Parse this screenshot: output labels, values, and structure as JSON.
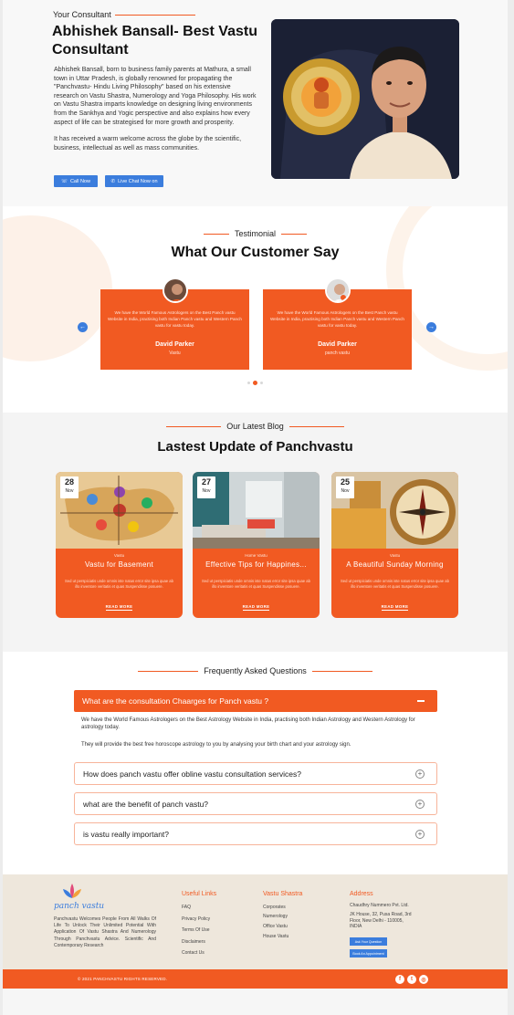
{
  "consultant": {
    "eyebrow": "Your Consultant",
    "title": "Abhishek Bansall- Best Vastu Consultant",
    "para1": "Abhishek Bansall, born to business family parents at Mathura, a small town in Uttar Pradesh, is globally renowned for propagating the \"Panchvastu- Hindu Living Philosophy\" based on his extensive research on Vastu Shastra, Numerology and Yoga Philosophy.  His work on Vastu Shastra imparts knowledge on designing living environments from the Sankhya and Yogic perspective and also explains how every aspect of life can be strategised for more growth and prosperity.",
    "para2": "It has received a warm welcome across the globe by the scientific, business, intellectual as well as mass communities.",
    "call_label": "Call Now",
    "chat_label": "Live Chat Now on"
  },
  "testimonial": {
    "eyebrow": "Testimonial",
    "title": "What Our Customer Say",
    "cards": [
      {
        "text": "We have the World Famous Astrologers on the Best Panch vastu Website in India, practising both Indian Panch vastu and Western Panch vastu for vastu today.",
        "name": "David Parker",
        "role": "Vastu"
      },
      {
        "text": "We have the World Famous Astrologers on the Best Panch vastu Website in India, practising both Indian Panch vastu and Western Panch vastu for vastu today.",
        "name": "David Parker",
        "role": "panch vastu"
      }
    ]
  },
  "blog": {
    "eyebrow": "Our Latest Blog",
    "title": "Lastest Update of Panchvastu",
    "read_more": "READ MORE",
    "posts": [
      {
        "day": "28",
        "month": "Nov",
        "category": "Vastu",
        "title": "Vastu for Basement",
        "excerpt": "Sed ut perspiciatis unde omnis iste natus error site ipsa quae ab illo inventore veritatis et quas Suspendisse posuere."
      },
      {
        "day": "27",
        "month": "Nov",
        "category": "Home Vastu",
        "title": "Effective  Tips for Happines...",
        "excerpt": "Sed ut perspiciatis unde omnis iste natus error site ipsa quae ab illo inventore veritatis et quas Suspendisse posuere."
      },
      {
        "day": "25",
        "month": "Nov",
        "category": "Vastu",
        "title": "A Beautiful Sunday Morning",
        "excerpt": "Sed ut perspiciatis unde omnis iste natus error site ipsa quae ab illo inventore veritatis et quas Suspendisse posuere."
      }
    ]
  },
  "faq": {
    "eyebrow": "Frequently Asked Questions",
    "open_question": "What are the consultation Chaarges for Panch vastu ?",
    "answer1": "We have the World Famous Astrologers on the Best Astrology Website in India, practising both Indian Astrology and Western Astrology for astrology today.",
    "answer2": "They will provide the best free horoscope astrology to you by analysing your birth chart and your astrology sign.",
    "questions": [
      "How does panch vastu offer obline vastu consultation services?",
      "what are the benefit of panch vastu?",
      "is vastu really important?"
    ]
  },
  "footer": {
    "logo_text": "panch vastu",
    "about": "Panchvastu Welcomes People From All Walks Of Life To Unlock Their Unlimited Potential With Application Of Vastu Shastra And Numerology Through Panchvastu Advice. Scientific And Contemporary Research",
    "useful_heading": "Useful Links",
    "useful_links": [
      "FAQ",
      "Privacy Policy",
      "Terms Of Use",
      "Disclaimers",
      "Contact Us"
    ],
    "vastu_heading": "Vastu Shastra",
    "vastu_links": [
      "Corporates",
      "Numerology",
      "Office Vastu",
      "House Vastu"
    ],
    "address_heading": "Address",
    "company": "Chaudhry Nummero Pvt. Ltd.",
    "address": "JK House, 32, Pusa Road, 3rd Floor, New Delhi - 110005, INDIA",
    "btn_question": "Ask Your Question",
    "btn_appointment": "Book An Appointment",
    "copyright": "© 2021 PANCHVASTU RIGHTS RESERVED.",
    "social_icons": [
      "facebook-icon",
      "twitter-icon",
      "instagram-icon"
    ]
  },
  "colors": {
    "accent": "#f15a22",
    "blue": "#3b7ddd",
    "footer_bg": "#eee7dc"
  }
}
